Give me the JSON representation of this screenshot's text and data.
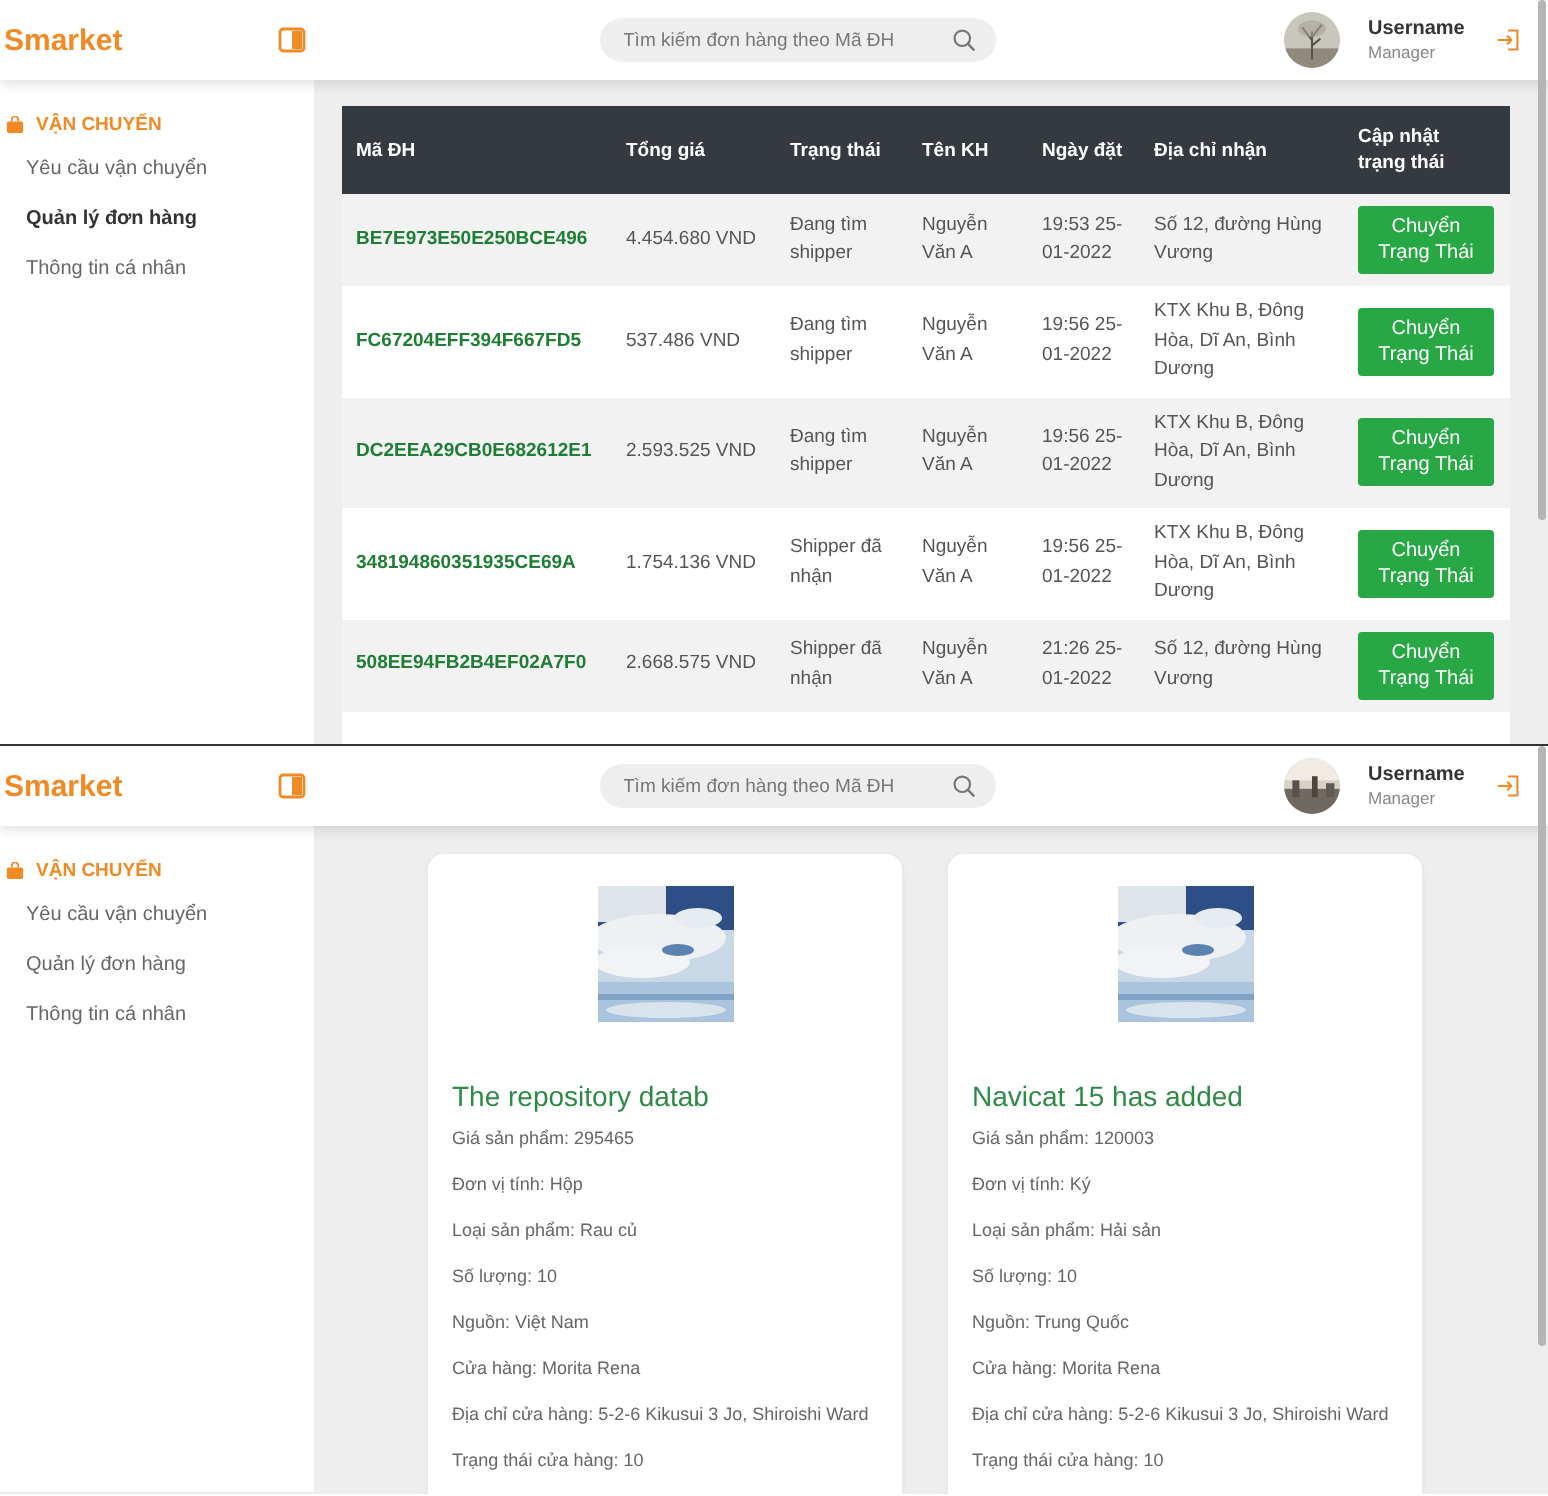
{
  "screens": [
    {
      "kind": "table",
      "header": {
        "logo": "Smarket",
        "search_placeholder": "Tìm kiếm đơn hàng theo Mã ĐH",
        "username": "Username",
        "role": "Manager"
      },
      "sidebar": {
        "section": "VẬN CHUYỂN",
        "items": [
          {
            "label": "Yêu cầu vận chuyển",
            "selected": false
          },
          {
            "label": "Quản lý đơn hàng",
            "selected": true
          },
          {
            "label": "Thông tin cá nhân",
            "selected": false
          }
        ]
      },
      "table": {
        "columns": [
          "Mã ĐH",
          "Tổng giá",
          "Trạng thái",
          "Tên KH",
          "Ngày đặt",
          "Địa chỉ nhận",
          "Cập nhật trạng thái"
        ],
        "rows": [
          {
            "id": "BE7E973E50E250BCE496",
            "total": "4.454.680 VND",
            "status": "Đang tìm shipper",
            "customer": "Nguyễn Văn A",
            "date": "19:53 25-01-2022",
            "address": "Số 12, đường Hùng Vương",
            "action": "Chuyển Trạng Thái"
          },
          {
            "id": "FC67204EFF394F667FD5",
            "total": "537.486 VND",
            "status": "Đang tìm shipper",
            "customer": "Nguyễn Văn A",
            "date": "19:56 25-01-2022",
            "address": "KTX Khu B, Đông Hòa, Dĩ An, Bình Dương",
            "action": "Chuyển Trạng Thái"
          },
          {
            "id": "DC2EEA29CB0E682612E1",
            "total": "2.593.525 VND",
            "status": "Đang tìm shipper",
            "customer": "Nguyễn Văn A",
            "date": "19:56 25-01-2022",
            "address": "KTX Khu B, Đông Hòa, Dĩ An, Bình Dương",
            "action": "Chuyển Trạng Thái"
          },
          {
            "id": "348194860351935CE69A",
            "total": "1.754.136 VND",
            "status": "Shipper đã nhận",
            "customer": "Nguyễn Văn A",
            "date": "19:56 25-01-2022",
            "address": "KTX Khu B, Đông Hòa, Dĩ An, Bình Dương",
            "action": "Chuyển Trạng Thái"
          },
          {
            "id": "508EE94FB2B4EF02A7F0",
            "total": "2.668.575 VND",
            "status": "Shipper đã nhận",
            "customer": "Nguyễn Văn A",
            "date": "21:26 25-01-2022",
            "address": "Số 12, đường Hùng Vương",
            "action": "Chuyển Trạng Thái"
          }
        ]
      }
    },
    {
      "kind": "cards",
      "header": {
        "logo": "Smarket",
        "search_placeholder": "Tìm kiếm đơn hàng theo Mã ĐH",
        "username": "Username",
        "role": "Manager"
      },
      "sidebar": {
        "section": "VẬN CHUYỂN",
        "items": [
          {
            "label": "Yêu cầu vận chuyển",
            "selected": false
          },
          {
            "label": "Quản lý đơn hàng",
            "selected": false
          },
          {
            "label": "Thông tin cá nhân",
            "selected": false
          }
        ]
      },
      "cards": [
        {
          "title": "The repository datab",
          "fields": [
            "Giá sản phẩm: 295465",
            "Đơn vị tính: Hộp",
            "Loại sản phẩm: Rau củ",
            "Số lượng: 10",
            "Nguồn: Việt Nam",
            "Cửa hàng: Morita Rena",
            "Địa chỉ cửa hàng: 5-2-6 Kikusui 3 Jo, Shiroishi Ward",
            "Trạng thái cửa hàng: 10"
          ]
        },
        {
          "title": "Navicat 15 has added",
          "fields": [
            "Giá sản phẩm: 120003",
            "Đơn vị tính: Ký",
            "Loại sản phẩm: Hải sản",
            "Số lượng: 10",
            "Nguồn: Trung Quốc",
            "Cửa hàng: Morita Rena",
            "Địa chỉ cửa hàng: 5-2-6 Kikusui 3 Jo, Shiroishi Ward",
            "Trạng thái cửa hàng: 10"
          ]
        }
      ]
    }
  ]
}
